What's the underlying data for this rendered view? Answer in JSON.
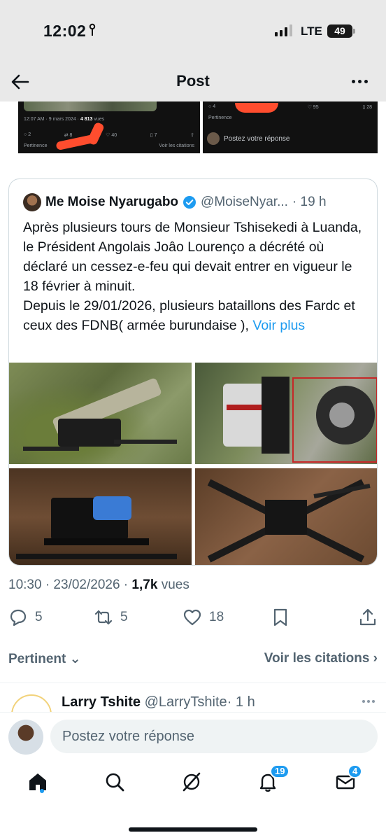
{
  "status_bar": {
    "time": "12:02",
    "network": "LTE",
    "battery": "49"
  },
  "header": {
    "title": "Post"
  },
  "embedded": {
    "left": {
      "meta_time": "12:07 AM · 9 mars 2024 ·",
      "meta_views": "4 813",
      "meta_views_suffix": "vues",
      "replies": "2",
      "reposts": "8",
      "likes": "40",
      "bookmarks": "7",
      "sort": "Pertinence",
      "quotes": "Voir les citations"
    },
    "right": {
      "replies": "4",
      "likes": "95",
      "bookmarks": "28",
      "sort": "Pertinence",
      "reply_placeholder": "Postez votre réponse"
    }
  },
  "quoted": {
    "name": "Me Moise Nyarugabo",
    "handle": "@MoiseNyar...",
    "time": "· 19 h",
    "text": "Après plusieurs tours de Monsieur Tshisekedi à Luanda, le Président Angolais Joâo Lourenço a décrété où déclaré un cessez-e-feu qui devait entrer en vigueur le 18 février à minuit.\nDepuis le 29/01/2026, plusieurs bataillons des Fardc et ceux des FDNB( armée burundaise ),",
    "more": "Voir plus"
  },
  "post": {
    "timestamp": "10:30 · 23/02/2026 ·",
    "views": "1,7k",
    "views_label": "vues",
    "replies": "5",
    "reposts": "5",
    "likes": "18"
  },
  "sort": {
    "left": "Pertinent",
    "right": "Voir les citations"
  },
  "next_reply": {
    "name": "Larry Tshite",
    "handle": "@LarryTshite",
    "time": "· 1 h"
  },
  "composer": {
    "placeholder": "Postez votre réponse"
  },
  "tabbar": {
    "notifications_badge": "19",
    "messages_badge": "4"
  },
  "colors": {
    "accent": "#1d9bf0",
    "text": "#0f1419",
    "secondary": "#536471",
    "scribble": "#ff4d2e"
  }
}
